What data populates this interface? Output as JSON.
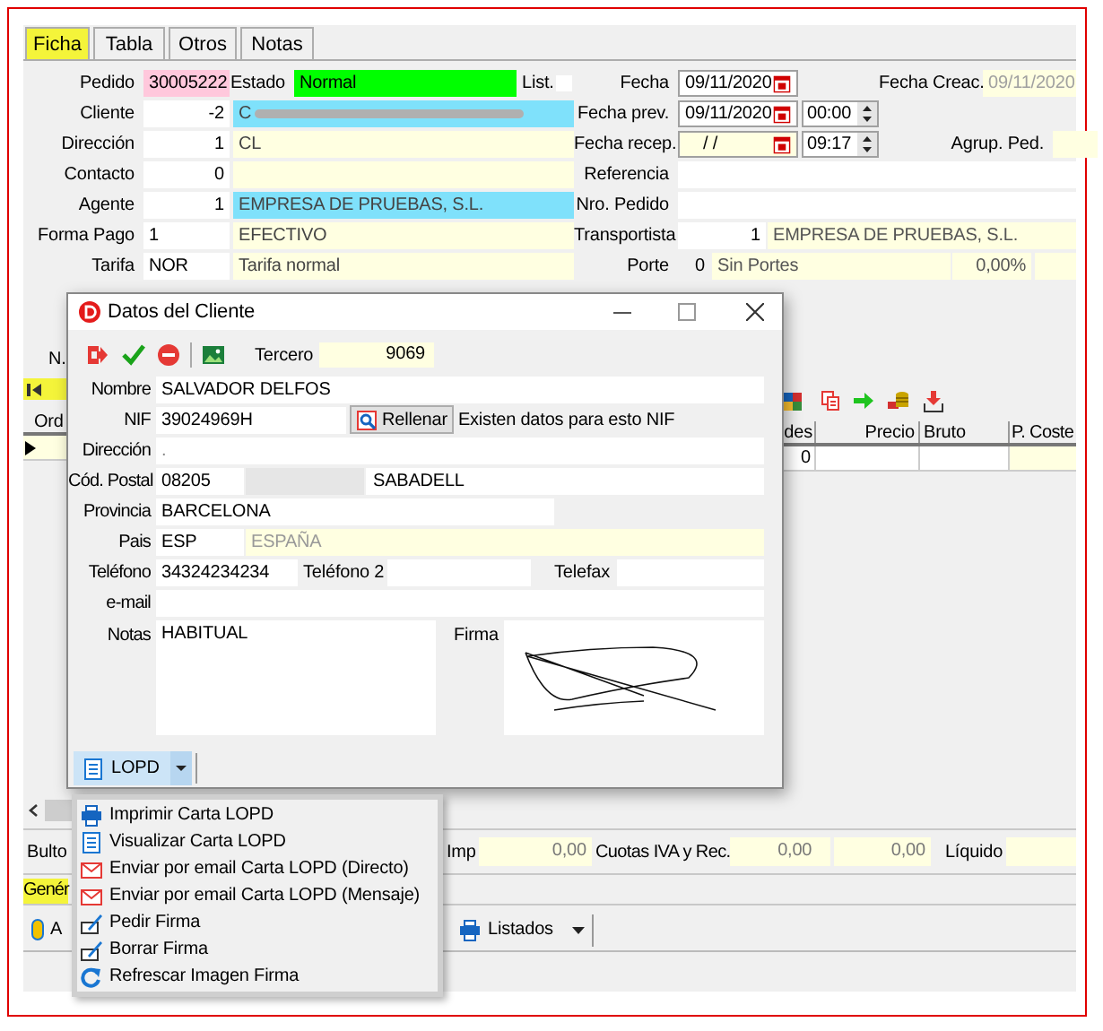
{
  "tabs": [
    {
      "label": "Ficha",
      "selected": true
    },
    {
      "label": "Tabla",
      "selected": false
    },
    {
      "label": "Otros",
      "selected": false
    },
    {
      "label": "Notas",
      "selected": false
    }
  ],
  "header": {
    "pedido": {
      "label": "Pedido",
      "value": "30005222"
    },
    "estado": {
      "label": "Estado",
      "value": "Normal"
    },
    "list": {
      "label": "List.",
      "checked": false
    }
  },
  "left_rows": [
    {
      "label": "Cliente",
      "kind": "number",
      "code": "-2",
      "name": "C",
      "redacted": true,
      "color": "#7fe1fb"
    },
    {
      "label": "Dirección",
      "kind": "number",
      "code": "1",
      "name": "CL",
      "redacted": false,
      "color": "#ffffe1"
    },
    {
      "label": "Contacto",
      "kind": "number",
      "code": "0",
      "redacted": false,
      "color": "#ffffe1"
    },
    {
      "label": "Agente",
      "kind": "number",
      "code": "1",
      "name": "EMPRESA DE PRUEBAS, S.L.",
      "redacted": false,
      "color": "#7fe1fb"
    },
    {
      "label": "Forma Pago",
      "kind": "code",
      "code": "1",
      "name": "EFECTIVO",
      "redacted": false,
      "color": "#ffffe1"
    },
    {
      "label": "Tarifa",
      "kind": "code",
      "code": "NOR",
      "name": "Tarifa normal",
      "redacted": false,
      "color": "#ffffe1"
    }
  ],
  "dates": {
    "fecha": {
      "label": "Fecha",
      "value": "09/11/2020"
    },
    "fecha_creac": {
      "label": "Fecha Creac.",
      "value": "09/11/2020"
    },
    "fecha_prev": {
      "label": "Fecha prev.",
      "value": "09/11/2020",
      "time": "00:00"
    },
    "fecha_recep": {
      "label": "Fecha recep.",
      "value": "/ /",
      "time": "09:17"
    },
    "agrup": {
      "label": "Agrup. Ped."
    }
  },
  "referencia": {
    "label": "Referencia"
  },
  "nro_pedido": {
    "label": "Nro. Pedido"
  },
  "transportista": {
    "label": "Transportista",
    "code": "1",
    "name": "EMPRESA DE PRUEBAS, S.L."
  },
  "porte": {
    "label": "Porte",
    "code": "0",
    "name": "Sin Portes",
    "percent": "0,00%"
  },
  "lines_label": "N.",
  "grid": {
    "columns": [
      "Ord",
      "des",
      "Precio",
      "Bruto",
      "P. Coste"
    ],
    "rows": [
      {
        "current": true,
        "des": "0"
      }
    ]
  },
  "dialog": {
    "title": "Datos del Cliente",
    "tercero_label": "Tercero",
    "tercero": "9069",
    "nombre": {
      "label": "Nombre",
      "value": "SALVADOR DELFOS"
    },
    "nif": {
      "label": "NIF",
      "value": "39024969H",
      "button": "Rellenar",
      "note": "Existen datos para esto NIF"
    },
    "direccion": {
      "label": "Dirección",
      "value": "."
    },
    "cod_postal": {
      "label": "Cód. Postal",
      "value": "08205",
      "city": "SABADELL"
    },
    "provincia": {
      "label": "Provincia",
      "value": "BARCELONA"
    },
    "pais": {
      "label": "Pais",
      "code": "ESP",
      "name": "ESPAÑA"
    },
    "telefono": {
      "label": "Teléfono",
      "value": "34324234234"
    },
    "telefono2": {
      "label": "Teléfono 2"
    },
    "telefax": {
      "label": "Telefax"
    },
    "email": {
      "label": "e-mail"
    },
    "notas": {
      "label": "Notas",
      "value": "HABITUAL"
    },
    "firma": {
      "label": "Firma"
    },
    "lopd_button": "LOPD"
  },
  "lopd_menu": [
    "Imprimir Carta LOPD",
    "Visualizar Carta LOPD",
    "Enviar por email Carta LOPD (Directo)",
    "Enviar por email Carta LOPD (Mensaje)",
    "Pedir Firma",
    "Borrar Firma",
    "Refrescar Imagen Firma"
  ],
  "totals": {
    "bultos_label": "Bulto",
    "imp_label": "Imp",
    "imp": "0,00",
    "cuotas_label": "Cuotas IVA y Rec.",
    "cuotas": "0,00",
    "cuotas_2": "0,00",
    "liquido_label": "Líquido"
  },
  "bottom_tabs": [
    {
      "label": "Genér",
      "selected": true
    }
  ],
  "bottom_toolbar": {
    "attach_label": "A",
    "listados": "Listados"
  }
}
